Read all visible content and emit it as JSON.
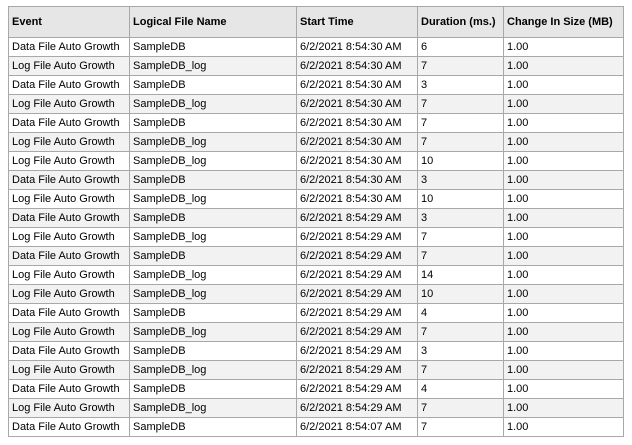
{
  "colors": {
    "header_bg": "#e6e6e6",
    "row_alt_bg": "#f2f2f2",
    "border": "#a8a8a8"
  },
  "table": {
    "headers": [
      "Event",
      "Logical File Name",
      "Start Time",
      "Duration (ms.)",
      "Change In Size (MB)"
    ],
    "rows": [
      [
        "Data File Auto Growth",
        "SampleDB",
        "6/2/2021 8:54:30 AM",
        "6",
        "1.00"
      ],
      [
        "Log File Auto Growth",
        "SampleDB_log",
        "6/2/2021 8:54:30 AM",
        "7",
        "1.00"
      ],
      [
        "Data File Auto Growth",
        "SampleDB",
        "6/2/2021 8:54:30 AM",
        "3",
        "1.00"
      ],
      [
        "Log File Auto Growth",
        "SampleDB_log",
        "6/2/2021 8:54:30 AM",
        "7",
        "1.00"
      ],
      [
        "Data File Auto Growth",
        "SampleDB",
        "6/2/2021 8:54:30 AM",
        "7",
        "1.00"
      ],
      [
        "Log File Auto Growth",
        "SampleDB_log",
        "6/2/2021 8:54:30 AM",
        "7",
        "1.00"
      ],
      [
        "Log File Auto Growth",
        "SampleDB_log",
        "6/2/2021 8:54:30 AM",
        "10",
        "1.00"
      ],
      [
        "Data File Auto Growth",
        "SampleDB",
        "6/2/2021 8:54:30 AM",
        "3",
        "1.00"
      ],
      [
        "Log File Auto Growth",
        "SampleDB_log",
        "6/2/2021 8:54:30 AM",
        "10",
        "1.00"
      ],
      [
        "Data File Auto Growth",
        "SampleDB",
        "6/2/2021 8:54:29 AM",
        "3",
        "1.00"
      ],
      [
        "Log File Auto Growth",
        "SampleDB_log",
        "6/2/2021 8:54:29 AM",
        "7",
        "1.00"
      ],
      [
        "Data File Auto Growth",
        "SampleDB",
        "6/2/2021 8:54:29 AM",
        "7",
        "1.00"
      ],
      [
        "Log File Auto Growth",
        "SampleDB_log",
        "6/2/2021 8:54:29 AM",
        "14",
        "1.00"
      ],
      [
        "Log File Auto Growth",
        "SampleDB_log",
        "6/2/2021 8:54:29 AM",
        "10",
        "1.00"
      ],
      [
        "Data File Auto Growth",
        "SampleDB",
        "6/2/2021 8:54:29 AM",
        "4",
        "1.00"
      ],
      [
        "Log File Auto Growth",
        "SampleDB_log",
        "6/2/2021 8:54:29 AM",
        "7",
        "1.00"
      ],
      [
        "Data File Auto Growth",
        "SampleDB",
        "6/2/2021 8:54:29 AM",
        "3",
        "1.00"
      ],
      [
        "Log File Auto Growth",
        "SampleDB_log",
        "6/2/2021 8:54:29 AM",
        "7",
        "1.00"
      ],
      [
        "Data File Auto Growth",
        "SampleDB",
        "6/2/2021 8:54:29 AM",
        "4",
        "1.00"
      ],
      [
        "Log File Auto Growth",
        "SampleDB_log",
        "6/2/2021 8:54:29 AM",
        "7",
        "1.00"
      ],
      [
        "Data File Auto Growth",
        "SampleDB",
        "6/2/2021 8:54:07 AM",
        "7",
        "1.00"
      ]
    ]
  }
}
